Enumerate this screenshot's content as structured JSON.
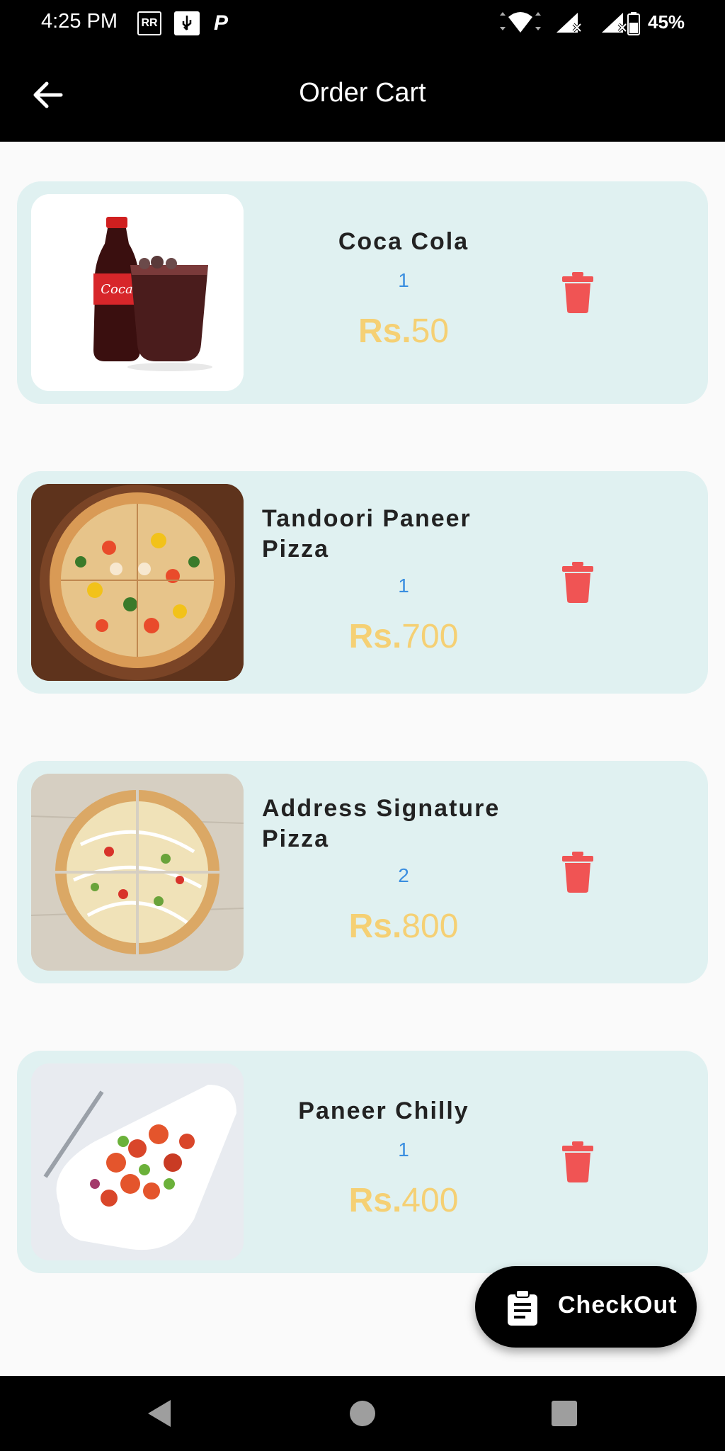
{
  "status_bar": {
    "time": "4:25 PM",
    "battery": "45%",
    "icons": [
      "sim-rr-icon",
      "usb-icon",
      "parking-icon",
      "wifi-icon",
      "signal-icon",
      "signal-icon-2",
      "battery-icon"
    ]
  },
  "app_bar": {
    "title": "Order Cart",
    "back_icon": "arrow-back-icon"
  },
  "cart_items": [
    {
      "name": "Coca Cola",
      "quantity": "1",
      "currency": "Rs.",
      "amount": "50",
      "image": "coca-cola-image"
    },
    {
      "name": "Tandoori Paneer Pizza",
      "quantity": "1",
      "currency": "Rs.",
      "amount": "700",
      "image": "tandoori-pizza-image"
    },
    {
      "name": "Address Signature Pizza",
      "quantity": "2",
      "currency": "Rs.",
      "amount": "800",
      "image": "signature-pizza-image"
    },
    {
      "name": "Paneer Chilly",
      "quantity": "1",
      "currency": "Rs.",
      "amount": "400",
      "image": "paneer-chilly-image"
    }
  ],
  "checkout": {
    "label": "CheckOut",
    "icon": "clipboard-icon"
  },
  "colors": {
    "card_bg": "#e0f1f1",
    "price": "#f5d074",
    "quantity": "#3a8ee0",
    "delete": "#f05454"
  }
}
